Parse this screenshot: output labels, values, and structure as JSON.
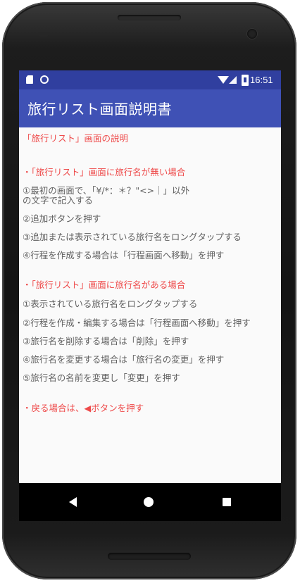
{
  "status_bar": {
    "time": "16:51",
    "icons": [
      "sd-card-icon",
      "circle-notification-icon",
      "wifi-icon",
      "signal-icon",
      "battery-icon"
    ]
  },
  "app_bar": {
    "title": "旅行リスト画面説明書"
  },
  "content": {
    "heading": "「旅行リスト」画面の説明",
    "section1": {
      "title": "・「旅行リスト」画面に旅行名が無い場合",
      "items": [
        "①最初の画面で、「¥/*：＊？\"<>｜」以外",
        "の文字で記入する",
        "②追加ボタンを押す",
        "③追加または表示されている旅行名をロングタップする",
        "④行程を作成する場合は「行程画面へ移動」を押す"
      ]
    },
    "section2": {
      "title": "・「旅行リスト」画面に旅行名がある場合",
      "items": [
        "①表示されている旅行名をロングタップする",
        "②行程を作成・編集する場合は「行程画面へ移動」を押す",
        "③旅行名を削除する場合は「削除」を押す",
        "④旅行名を変更する場合は「旅行名の変更」を押す",
        "⑤旅行名の名前を変更し「変更」を押す"
      ]
    },
    "back_note": "・戻る場合は、◀ボタンを押す"
  },
  "nav_bar": {
    "buttons": [
      "back-icon",
      "home-icon",
      "recent-apps-icon"
    ]
  },
  "colors": {
    "status_bar": "#303f9f",
    "app_bar": "#3f51b5",
    "accent_red": "#ee4a4a",
    "body_text": "#555555"
  }
}
